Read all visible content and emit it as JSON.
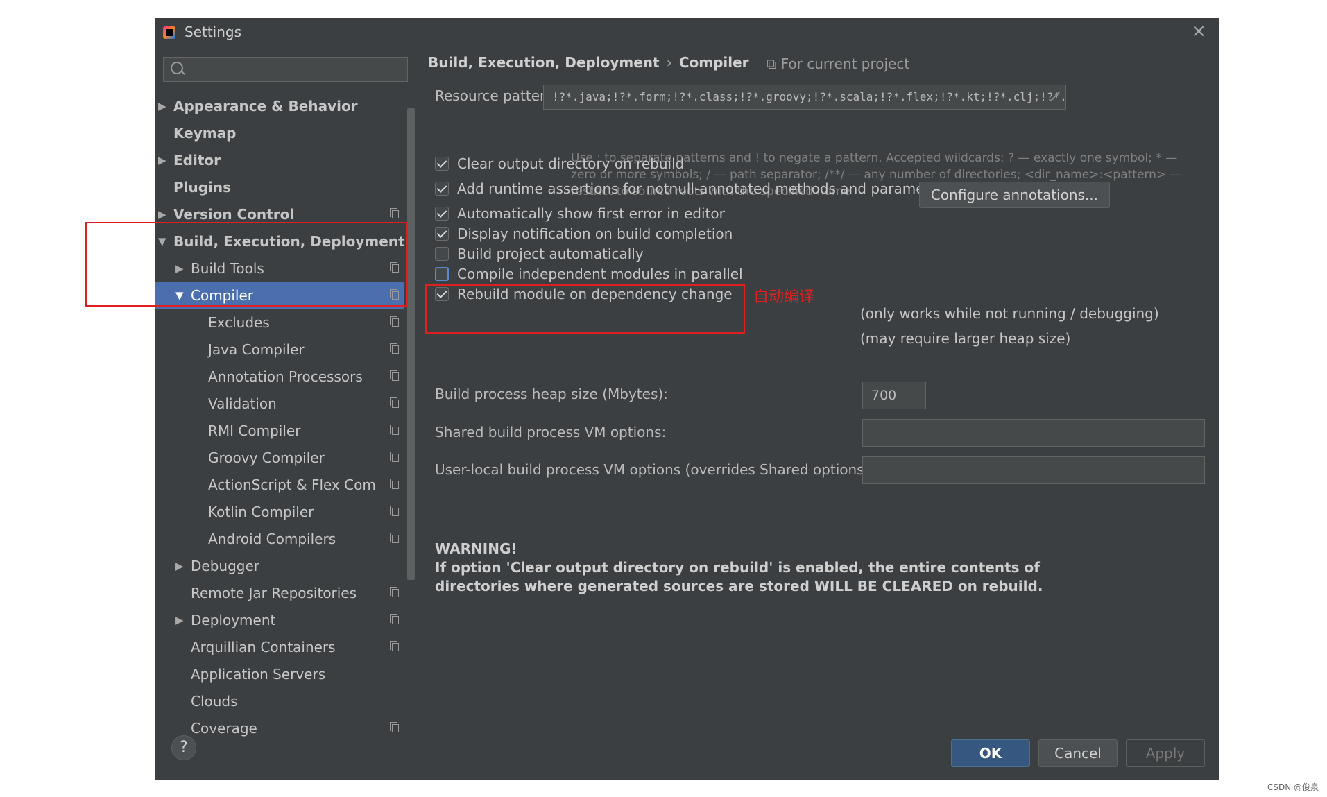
{
  "window": {
    "title": "Settings"
  },
  "search": {
    "value": "",
    "placeholder": ""
  },
  "sidebar": {
    "items": [
      {
        "label": "Appearance & Behavior",
        "level": 0,
        "expandable": true,
        "expanded": false,
        "bold": true,
        "project": false
      },
      {
        "label": "Keymap",
        "level": 0,
        "expandable": false,
        "bold": true,
        "project": false
      },
      {
        "label": "Editor",
        "level": 0,
        "expandable": true,
        "expanded": false,
        "bold": true,
        "project": false
      },
      {
        "label": "Plugins",
        "level": 0,
        "expandable": false,
        "bold": true,
        "project": false
      },
      {
        "label": "Version Control",
        "level": 0,
        "expandable": true,
        "expanded": false,
        "bold": true,
        "project": true
      },
      {
        "label": "Build, Execution, Deployment",
        "level": 0,
        "expandable": true,
        "expanded": true,
        "bold": true,
        "project": false
      },
      {
        "label": "Build Tools",
        "level": 1,
        "expandable": true,
        "expanded": false,
        "project": true
      },
      {
        "label": "Compiler",
        "level": 1,
        "expandable": true,
        "expanded": true,
        "selected": true,
        "project": true
      },
      {
        "label": "Excludes",
        "level": 2,
        "project": true
      },
      {
        "label": "Java Compiler",
        "level": 2,
        "project": true
      },
      {
        "label": "Annotation Processors",
        "level": 2,
        "project": true
      },
      {
        "label": "Validation",
        "level": 2,
        "project": true
      },
      {
        "label": "RMI Compiler",
        "level": 2,
        "project": true
      },
      {
        "label": "Groovy Compiler",
        "level": 2,
        "project": true
      },
      {
        "label": "ActionScript & Flex Com",
        "level": 2,
        "project": true
      },
      {
        "label": "Kotlin Compiler",
        "level": 2,
        "project": true
      },
      {
        "label": "Android Compilers",
        "level": 2,
        "project": true
      },
      {
        "label": "Debugger",
        "level": 1,
        "expandable": true,
        "expanded": false,
        "project": false
      },
      {
        "label": "Remote Jar Repositories",
        "level": 1,
        "project": true
      },
      {
        "label": "Deployment",
        "level": 1,
        "expandable": true,
        "expanded": false,
        "project": true
      },
      {
        "label": "Arquillian Containers",
        "level": 1,
        "project": true
      },
      {
        "label": "Application Servers",
        "level": 1,
        "project": false
      },
      {
        "label": "Clouds",
        "level": 1,
        "project": false
      },
      {
        "label": "Coverage",
        "level": 1,
        "project": true
      }
    ]
  },
  "breadcrumb": {
    "parent": "Build, Execution, Deployment",
    "separator": "›",
    "current": "Compiler",
    "scope": "For current project"
  },
  "resource_patterns": {
    "label": "Resource patterns:",
    "value": "!?*.java;!?*.form;!?*.class;!?*.groovy;!?*.scala;!?*.flex;!?*.kt;!?*.clj;!?*.aj",
    "hint_line1_a": "Use ",
    "hint_line1_b": "; to separate patterns and ",
    "hint_line1_c": "! to negate a pattern. Accepted wildcards: ",
    "hint_line1_d": "? — exactly one symbol; ",
    "hint_line1_e": "* —",
    "hint_line2": "zero or more symbols; / — path separator; /**/ — any number of directories; <dir_name>:<pattern> —",
    "hint_line3": "restrict to source roots with the specified name"
  },
  "options": [
    {
      "label": "Clear output directory on rebuild",
      "checked": true
    },
    {
      "label": "Add runtime assertions for notnull-annotated methods and parameters",
      "checked": true
    },
    {
      "label": "Automatically show first error in editor",
      "checked": true
    },
    {
      "label": "Display notification on build completion",
      "checked": true
    },
    {
      "label": "Build project automatically",
      "checked": false
    },
    {
      "label": "Compile independent modules in parallel",
      "checked": false
    },
    {
      "label": "Rebuild module on dependency change",
      "checked": true
    }
  ],
  "configure_annotations_label": "Configure annotations...",
  "notes": {
    "build_auto": "(only works while not running / debugging)",
    "parallel": "(may require larger heap size)"
  },
  "annotation_text": "自动编译",
  "heap": {
    "label": "Build process heap size (Mbytes):",
    "value": "700"
  },
  "shared_vm": {
    "label": "Shared build process VM options:",
    "value": ""
  },
  "user_vm": {
    "label": "User-local build process VM options (overrides Shared options):",
    "value": ""
  },
  "warning": {
    "title": "WARNING!",
    "body": "If option 'Clear output directory on rebuild' is enabled, the entire contents of directories where generated sources are stored WILL BE CLEARED on rebuild."
  },
  "buttons": {
    "ok": "OK",
    "cancel": "Cancel",
    "apply": "Apply",
    "help": "?"
  },
  "watermark": "CSDN @俊泉",
  "colors": {
    "dialog_bg": "#3c3f41",
    "selection": "#4b6eaf",
    "primary_button": "#365880",
    "annotation_red": "#e02020"
  }
}
